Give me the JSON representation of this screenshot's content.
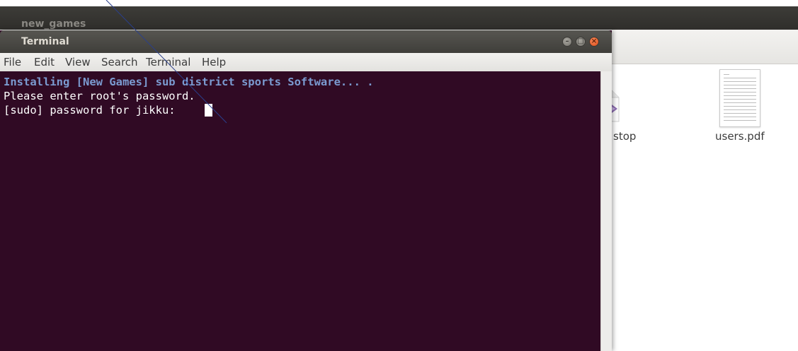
{
  "file_manager": {
    "title": "new_games",
    "items": [
      {
        "label": "stop",
        "icon": "desktop-file-icon"
      },
      {
        "label": "users.pdf",
        "icon": "pdf-document-icon"
      }
    ]
  },
  "terminal": {
    "title": "Terminal",
    "window_buttons": {
      "minimize": "–",
      "maximize": "□",
      "close": "×"
    },
    "menu": [
      "File",
      "Edit",
      "View",
      "Search",
      "Terminal",
      "Help"
    ],
    "lines": [
      "Installing [New Games] sub district sports Software... .",
      "Please enter root's password.",
      "[sudo] password for jikku: "
    ]
  },
  "colors": {
    "terminal_bg": "#300a24",
    "highlight_text": "#7b9bd1",
    "close_button": "#df4a16",
    "titlebar": "#3f3e3a"
  }
}
